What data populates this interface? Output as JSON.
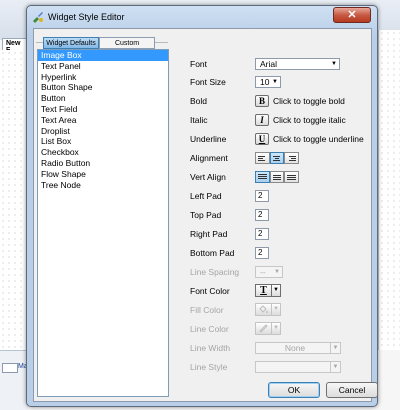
{
  "background": {
    "tab_label": "New F",
    "bottom_text": "Ma"
  },
  "dialog": {
    "title": "Widget Style Editor",
    "close_glyph": "✕",
    "tabs": [
      {
        "label": "Widget Defaults",
        "active": true
      },
      {
        "label": "Custom",
        "active": false
      }
    ],
    "widgets": [
      "Image Box",
      "Text Panel",
      "Hyperlink",
      "Button Shape",
      "Button",
      "Text Field",
      "Text Area",
      "Droplist",
      "List Box",
      "Checkbox",
      "Radio Button",
      "Flow Shape",
      "Tree Node"
    ],
    "selected_widget": "Image Box",
    "properties": {
      "font": {
        "label": "Font",
        "value": "Arial"
      },
      "font_size": {
        "label": "Font Size",
        "value": "10"
      },
      "bold": {
        "label": "Bold",
        "button": "B",
        "text": "Click to toggle bold"
      },
      "italic": {
        "label": "Italic",
        "button": "I",
        "text": "Click to toggle italic"
      },
      "underline": {
        "label": "Underline",
        "button": "U",
        "text": "Click to toggle underline"
      },
      "alignment": {
        "label": "Alignment",
        "selected": "center"
      },
      "vert_align": {
        "label": "Vert Align",
        "selected": "top"
      },
      "left_pad": {
        "label": "Left Pad",
        "value": "2"
      },
      "top_pad": {
        "label": "Top Pad",
        "value": "2"
      },
      "right_pad": {
        "label": "Right Pad",
        "value": "2"
      },
      "bottom_pad": {
        "label": "Bottom Pad",
        "value": "2"
      },
      "line_spacing": {
        "label": "Line Spacing",
        "value": "--",
        "disabled": true
      },
      "font_color": {
        "label": "Font Color",
        "button": "T"
      },
      "fill_color": {
        "label": "Fill Color",
        "disabled": true
      },
      "line_color": {
        "label": "Line Color",
        "disabled": true
      },
      "line_width": {
        "label": "Line Width",
        "value": "None",
        "disabled": true
      },
      "line_style": {
        "label": "Line Style",
        "value": "",
        "disabled": true
      }
    },
    "buttons": {
      "ok": "OK",
      "cancel": "Cancel"
    },
    "colors": {
      "selection": "#3399ff",
      "title_bar": "#b9cfe8",
      "close_button": "#c75a44"
    },
    "icons": {
      "app": "widget-style-icon",
      "fill": "paint-bucket-icon",
      "line": "pencil-icon"
    }
  }
}
